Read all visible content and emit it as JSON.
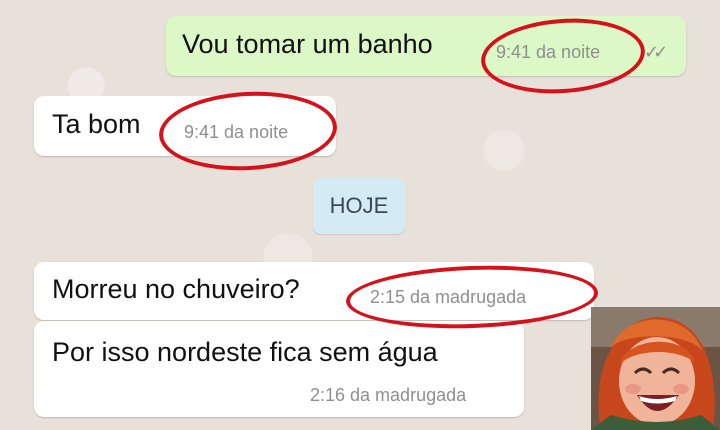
{
  "messages": [
    {
      "id": "outgoing-1",
      "direction": "outgoing",
      "text": "Vou tomar um banho",
      "time": "9:41 da noite",
      "status": "read-double-check"
    },
    {
      "id": "incoming-1",
      "direction": "incoming",
      "text": "Ta bom",
      "time": "9:41 da noite"
    },
    {
      "id": "incoming-2",
      "direction": "incoming",
      "text": "Morreu no chuveiro?",
      "time": "2:15 da madrugada"
    },
    {
      "id": "incoming-3",
      "direction": "incoming",
      "text": "Por isso nordeste fica sem água",
      "time": "2:16 da madrugada"
    }
  ],
  "day_divider": "HOJE",
  "ticks_glyph": "✓✓",
  "colors": {
    "outgoing_bubble": "#dcf8c6",
    "incoming_bubble": "#ffffff",
    "day_chip": "#d4eaf4",
    "highlight_circle": "#d5121b",
    "timestamp": "#8f8f8f"
  }
}
